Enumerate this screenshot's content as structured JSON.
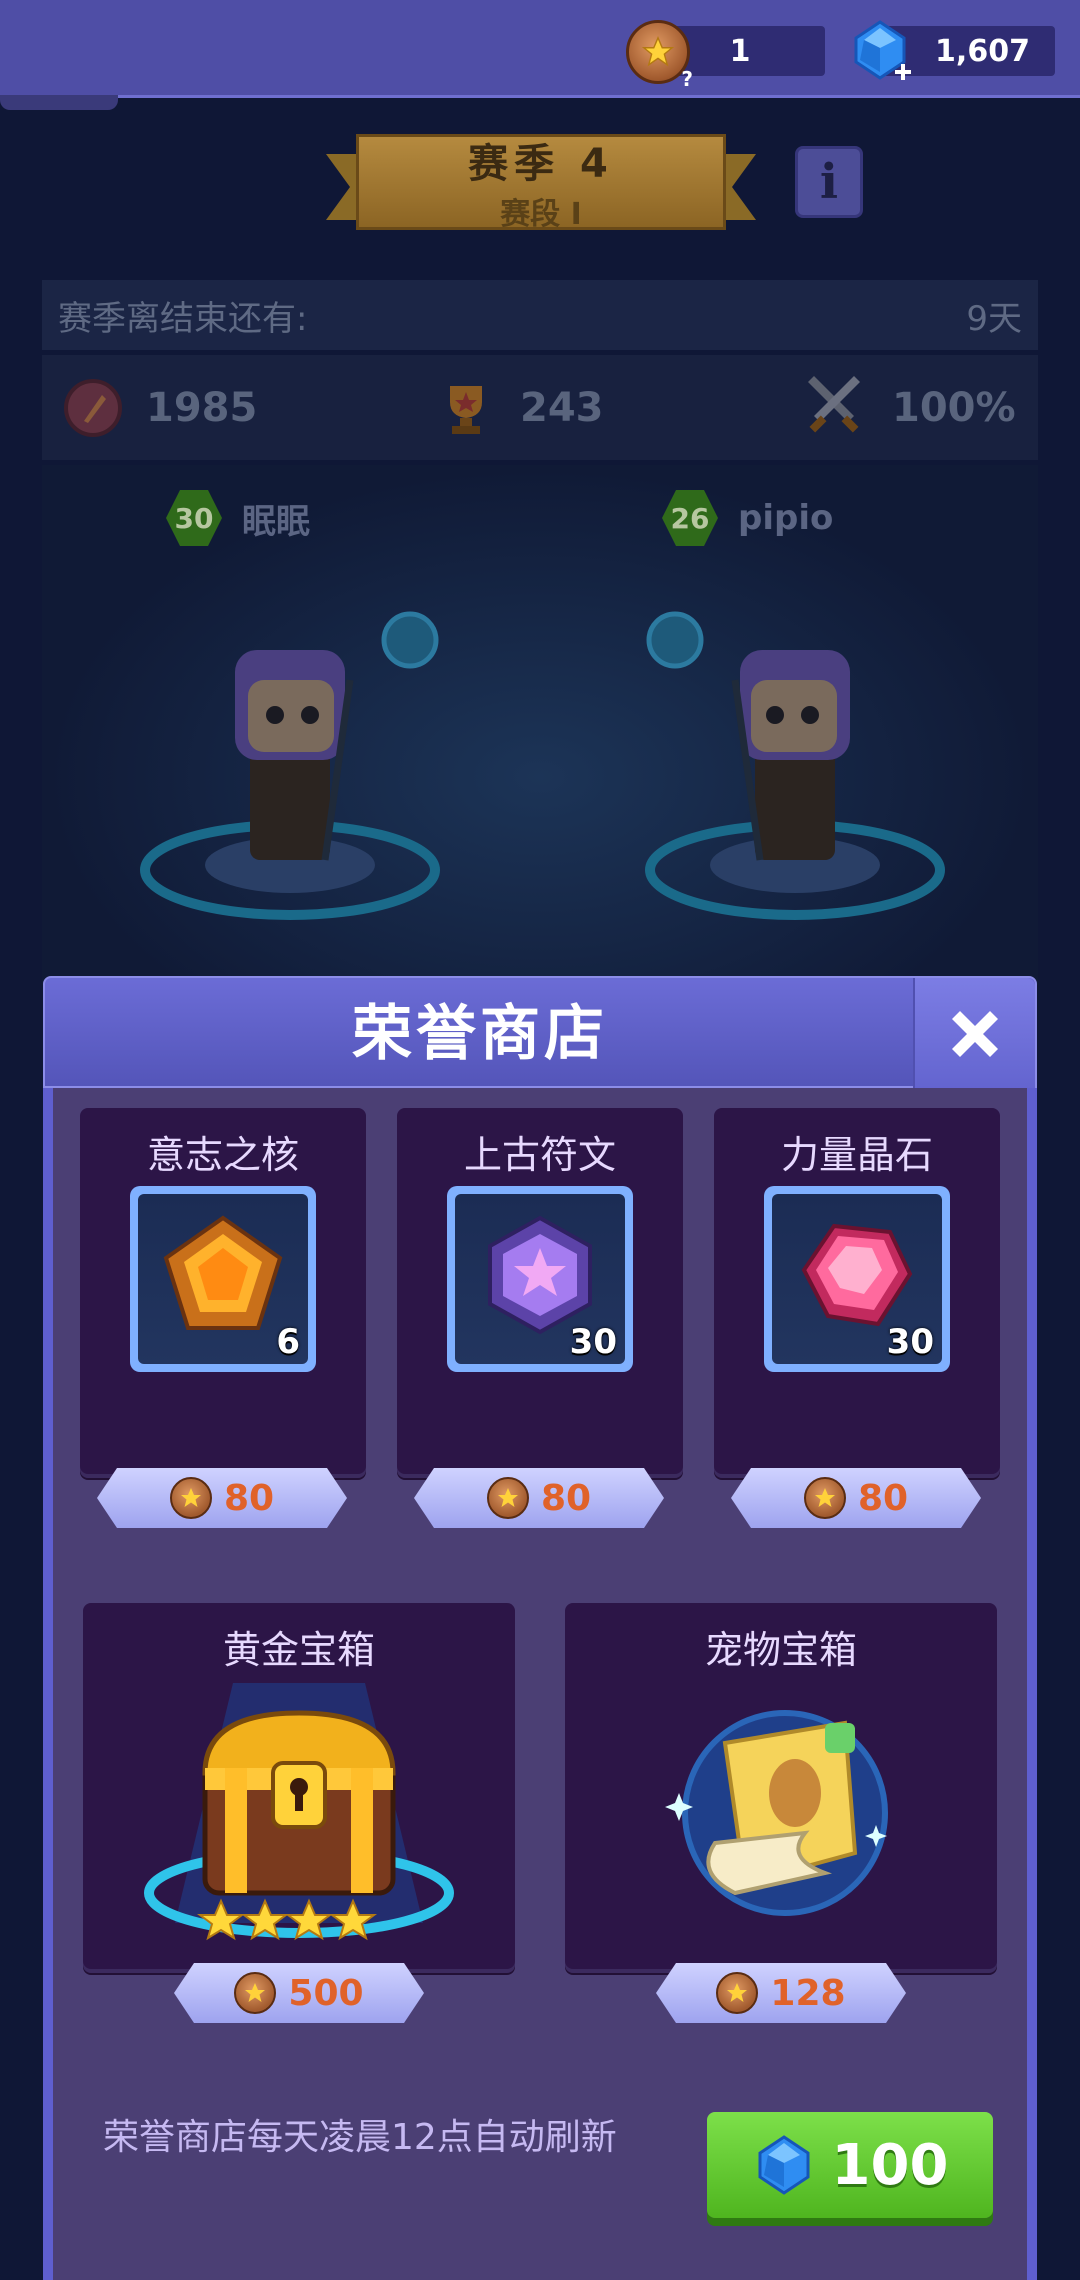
{
  "topbar": {
    "medal_count": "1",
    "medal_help": "?",
    "gem_count": "1,607",
    "gem_plus": "+"
  },
  "season": {
    "title": "赛季 4",
    "stage": "赛段 I",
    "info_label": "i",
    "end_label": "赛季离结束还有:",
    "end_value": "9天",
    "honor_value": "1985",
    "trophy_value": "243",
    "winrate_value": "100%"
  },
  "players": [
    {
      "level": "30",
      "name": "眠眠"
    },
    {
      "level": "26",
      "name": "pipio"
    }
  ],
  "shop": {
    "title": "荣誉商店",
    "items": [
      {
        "name": "意志之核",
        "qty": "6",
        "price": "80",
        "icon": "will-core-icon"
      },
      {
        "name": "上古符文",
        "qty": "30",
        "price": "80",
        "icon": "ancient-rune-icon"
      },
      {
        "name": "力量晶石",
        "qty": "30",
        "price": "80",
        "icon": "power-crystal-icon"
      }
    ],
    "chests": [
      {
        "name": "黄金宝箱",
        "price": "500",
        "icon": "gold-chest-icon"
      },
      {
        "name": "宠物宝箱",
        "price": "128",
        "icon": "pet-chest-icon"
      }
    ],
    "refresh_note": "荣誉商店每天凌晨12点自动刷新",
    "refresh_cost": "100"
  },
  "colors": {
    "price_text": "#e0622a",
    "accent_purple": "#5f5fcf",
    "buy_green": "#4fb51f"
  }
}
